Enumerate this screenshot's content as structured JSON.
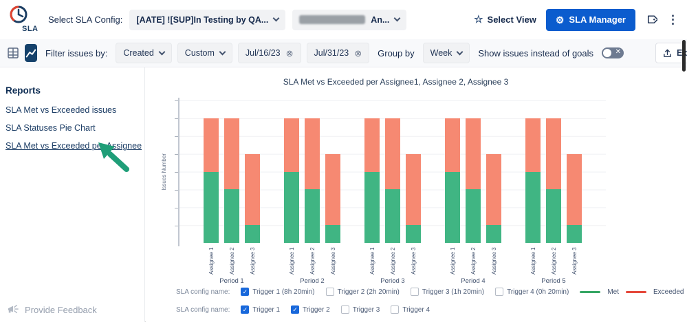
{
  "colors": {
    "accent_blue": "#0b5cce",
    "checkbox_blue": "#1868db",
    "arrow_green": "#1f9e78",
    "navy": "#172b4d"
  },
  "header": {
    "logo_text": "SLA",
    "select_config_label": "Select SLA Config:",
    "config_dropdown_1": "[AATE] ![SUP]In Testing by QA...",
    "config_dropdown_2": "An...",
    "select_view_label": "Select View",
    "sla_manager_label": "SLA Manager"
  },
  "toolbar": {
    "filter_label": "Filter issues by:",
    "created_value": "Created",
    "custom_value": "Custom",
    "date_from": "Jul/16/23",
    "date_to": "Jul/31/23",
    "group_by_label": "Group by",
    "group_by_value": "Week",
    "toggle_label": "Show issues instead of goals",
    "export_label": "Export"
  },
  "sidebar": {
    "title": "Reports",
    "items": [
      {
        "label": "SLA Met vs Exceeded issues",
        "active": false
      },
      {
        "label": "SLA Statuses Pie Chart",
        "active": false
      },
      {
        "label": "SLA Met vs Exceeded per Assignee",
        "active": true
      }
    ],
    "feedback_label": "Provide Feedback"
  },
  "chart_data": {
    "type": "bar",
    "stacked": true,
    "title": "SLA Met vs Exceeded per Assignee1, Assignee 2, Assignee 3",
    "ylabel": "Issues Number",
    "ylim": [
      0,
      8
    ],
    "grid": true,
    "categories": [
      "Period 1",
      "Period 2",
      "Period 3",
      "Period 4",
      "Period 5"
    ],
    "bar_labels": [
      "Assignee 1",
      "Assignee 2",
      "Assignee 3"
    ],
    "series": [
      {
        "name": "Met",
        "color": "#40b583",
        "per_group": [
          [
            4,
            3,
            1
          ],
          [
            4,
            3,
            1
          ],
          [
            4,
            3,
            1
          ],
          [
            4,
            3,
            1
          ],
          [
            4,
            3,
            1
          ]
        ]
      },
      {
        "name": "Exceeded",
        "color": "#f68972",
        "per_group": [
          [
            3,
            4,
            4
          ],
          [
            3,
            4,
            4
          ],
          [
            3,
            4,
            4
          ],
          [
            3,
            4,
            4
          ],
          [
            3,
            4,
            4
          ]
        ]
      }
    ]
  },
  "legend": {
    "row1": {
      "label": "SLA config name:",
      "items": [
        {
          "label": "Trigger 1 (8h 20min)",
          "checked": true
        },
        {
          "label": "Trigger 2 (2h 20min)",
          "checked": false
        },
        {
          "label": "Trigger 3 (1h 20min)",
          "checked": false
        },
        {
          "label": "Trigger 4 (0h 20min)",
          "checked": false
        }
      ]
    },
    "row2": {
      "label": "SLA config name:",
      "items": [
        {
          "label": "Trigger 1",
          "checked": true
        },
        {
          "label": "Trigger 2",
          "checked": true
        },
        {
          "label": "Trigger 3",
          "checked": false
        },
        {
          "label": "Trigger 4",
          "checked": false
        }
      ]
    },
    "series": [
      {
        "label": "Met",
        "color": "#36a664"
      },
      {
        "label": "Exceeded",
        "color": "#e5483b"
      }
    ]
  }
}
